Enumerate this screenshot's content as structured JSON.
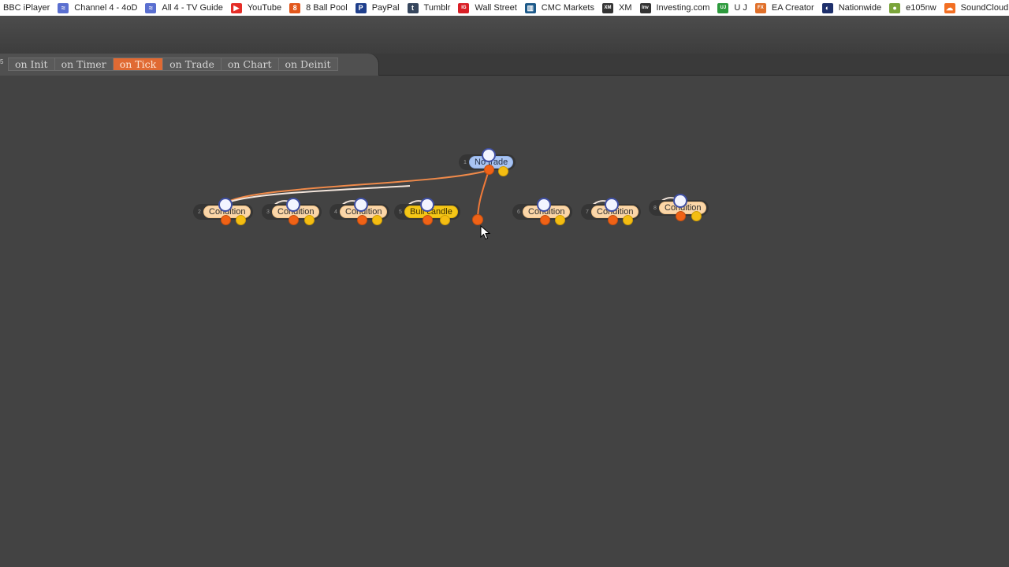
{
  "bookmarks": [
    {
      "label": "BBC iPlayer",
      "icon": "bbc-icon",
      "color": "#ffffff"
    },
    {
      "label": "Channel 4 - 4oD",
      "icon": "channel4-icon",
      "color": "#5a6fd0"
    },
    {
      "label": "All 4 - TV Guide",
      "icon": "all4-icon",
      "color": "#5a6fd0"
    },
    {
      "label": "YouTube",
      "icon": "youtube-icon",
      "color": "#e52d27"
    },
    {
      "label": "8 Ball Pool",
      "icon": "8ball-icon",
      "color": "#e2571b"
    },
    {
      "label": "PayPal",
      "icon": "paypal-icon",
      "color": "#1f3f8c"
    },
    {
      "label": "Tumblr",
      "icon": "tumblr-icon",
      "color": "#36465d"
    },
    {
      "label": "Wall Street",
      "icon": "ig-icon",
      "color": "#d91f26"
    },
    {
      "label": "CMC Markets",
      "icon": "cmc-icon",
      "color": "#1d5a8a"
    },
    {
      "label": "XM",
      "icon": "xm-icon",
      "color": "#333333"
    },
    {
      "label": "Investing.com",
      "icon": "investing-icon",
      "color": "#333333"
    },
    {
      "label": "U J",
      "icon": "uj-icon",
      "color": "#2d9a3d"
    },
    {
      "label": "EA Creator",
      "icon": "fx-icon",
      "color": "#e0702a"
    },
    {
      "label": "Nationwide",
      "icon": "nationwide-icon",
      "color": "#1d2f6b"
    },
    {
      "label": "e105nw",
      "icon": "e105-icon",
      "color": "#7aa43a"
    },
    {
      "label": "SoundCloud",
      "icon": "soundcloud-icon",
      "color": "#f26f23"
    }
  ],
  "tabs": [
    {
      "label": "on Init",
      "active": false
    },
    {
      "label": "on Timer",
      "active": false
    },
    {
      "label": "on Tick",
      "active": true
    },
    {
      "label": "on Trade",
      "active": false
    },
    {
      "label": "on Chart",
      "active": false
    },
    {
      "label": "on Deinit",
      "active": false
    }
  ],
  "tab_number": "5",
  "nodes": [
    {
      "id": "1",
      "label": "No trade",
      "style": "blue"
    },
    {
      "id": "2",
      "label": "Condition",
      "style": "orange"
    },
    {
      "id": "3",
      "label": "Condition",
      "style": "orange"
    },
    {
      "id": "4",
      "label": "Condition",
      "style": "orange"
    },
    {
      "id": "5",
      "label": "Bull candle",
      "style": "yellow"
    },
    {
      "id": "6",
      "label": "Condition",
      "style": "orange"
    },
    {
      "id": "7",
      "label": "Condition",
      "style": "orange"
    },
    {
      "id": "8",
      "label": "Condition",
      "style": "orange"
    }
  ],
  "colors": {
    "background": "#434343",
    "active_tab": "#e06a33",
    "link_orange": "#f07a3a",
    "link_white": "#f0e8e0"
  }
}
